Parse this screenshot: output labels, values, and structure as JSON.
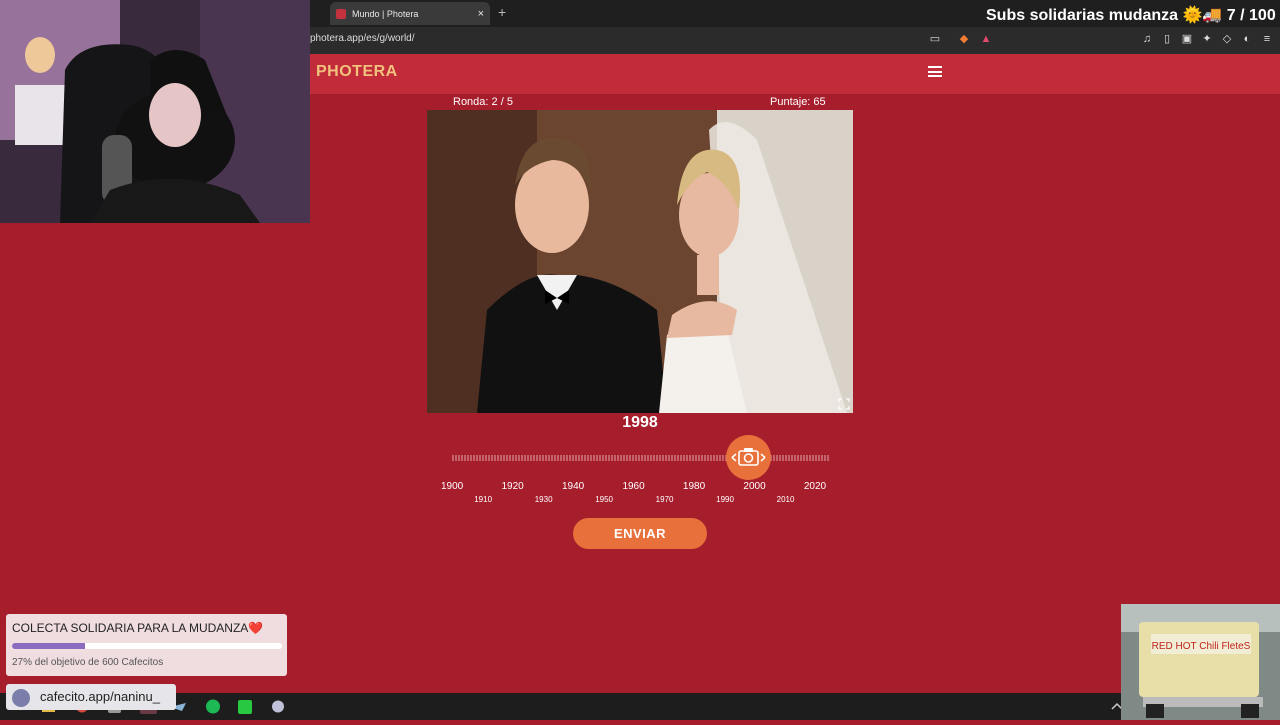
{
  "browser": {
    "tab_title": "Mundo | Photera",
    "tab_close": "×",
    "new_tab": "+",
    "url": "photera.app/es/g/world/"
  },
  "stream": {
    "title": "Subs solidarias mudanza 🌞🚚 7 / 100"
  },
  "site": {
    "logo": "PHOTERA"
  },
  "game": {
    "round": "Ronda: 2 / 5",
    "score": "Puntaje: 65",
    "year": "1998",
    "slider": {
      "min": 1900,
      "max": 2025,
      "value": 1998
    },
    "main_labels": [
      "1900",
      "1920",
      "1940",
      "1960",
      "1980",
      "2000",
      "2020"
    ],
    "sub_labels": [
      "1910",
      "1930",
      "1950",
      "1970",
      "1990",
      "2010"
    ],
    "submit": "ENVIAR"
  },
  "donation": {
    "title": "COLECTA SOLIDARIA PARA LA MUDANZA❤️",
    "progress": 0.27,
    "subtitle": "27% del objetivo de 600 Cafecitos",
    "link": "cafecito.app/naninu_"
  },
  "truck_sign": "RED HOT Chili FleteS",
  "colors": {
    "background": "#a61d2c",
    "header": "#c12b3a",
    "accent": "#e8703a",
    "logo": "#f1c27d"
  }
}
